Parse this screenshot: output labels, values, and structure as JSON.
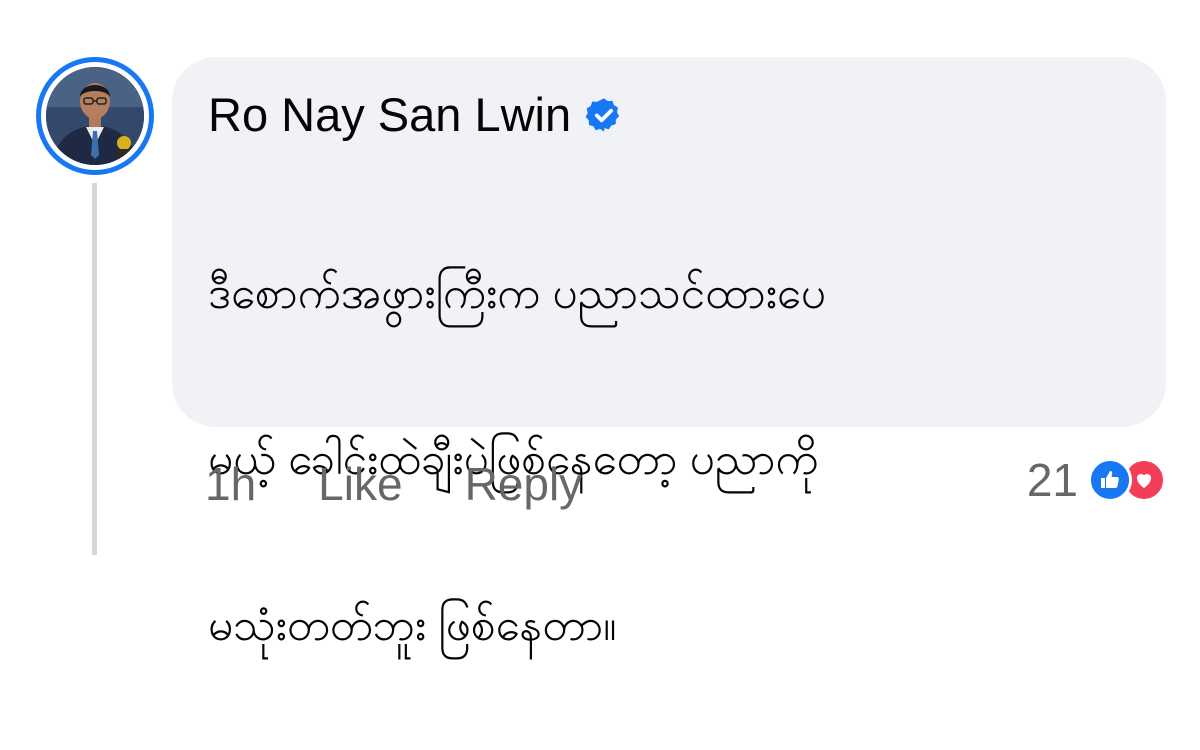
{
  "comment": {
    "author": "Ro Nay San Lwin",
    "verified": true,
    "text_lines": [
      "ဒီစောက်အဖွားကြီးက ပညာသင်ထားပေ",
      "မယ့် ခေါင်းထဲချီးပဲဖြစ်နေတော့ ပညာကို",
      "မသုံးတတ်ဘူး ဖြစ်နေတာ။"
    ]
  },
  "actions": {
    "time": "1h",
    "like_label": "Like",
    "reply_label": "Reply"
  },
  "reactions": {
    "count": "21",
    "types": [
      "like-icon",
      "love-icon"
    ]
  },
  "colors": {
    "accent": "#1877f2",
    "bubble_bg": "#f0f2f5",
    "secondary_text": "#65676b",
    "love": "#f33e58",
    "thread_line": "#d4d6da"
  }
}
